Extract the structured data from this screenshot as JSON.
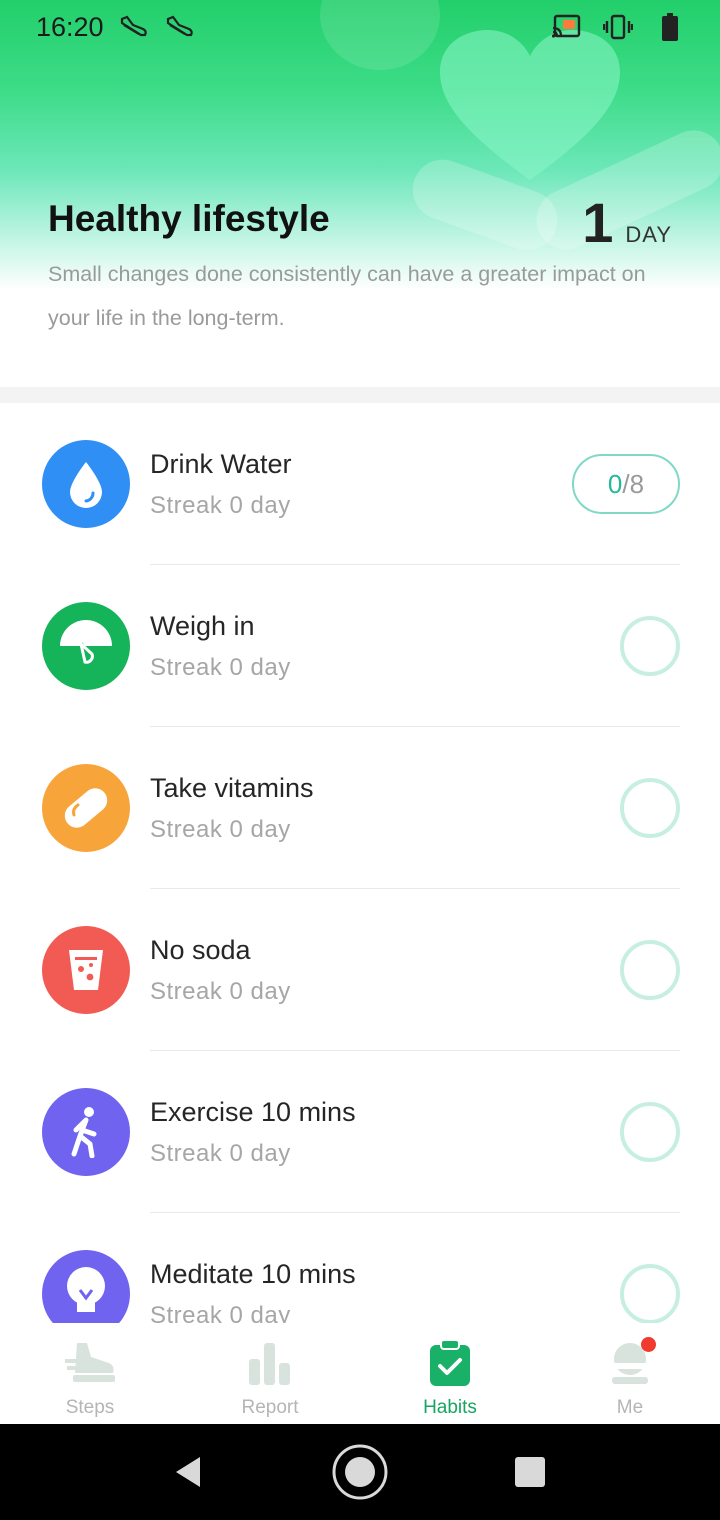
{
  "status_bar": {
    "time": "16:20",
    "left_icons": [
      "shoe-icon",
      "shoe-icon"
    ],
    "right_icons": [
      "cast-icon",
      "vibrate-icon",
      "battery-icon"
    ]
  },
  "header": {
    "title": "Healthy lifestyle",
    "day_count": "1",
    "day_unit": "DAY",
    "subtitle": "Small changes done consistently can have a greater impact on your life in the long-term."
  },
  "habits": [
    {
      "name": "Drink Water",
      "streak": "Streak 0 day",
      "icon": "water-drop-icon",
      "color": "#2f8ff5",
      "counter": {
        "current": "0",
        "separator": "/",
        "total": "8"
      }
    },
    {
      "name": "Weigh in",
      "streak": "Streak 0 day",
      "icon": "scale-icon",
      "color": "#15b35a"
    },
    {
      "name": "Take vitamins",
      "streak": "Streak 0 day",
      "icon": "pill-icon",
      "color": "#f7a53b"
    },
    {
      "name": "No soda",
      "streak": "Streak 0 day",
      "icon": "soda-cup-icon",
      "color": "#f25b54"
    },
    {
      "name": "Exercise 10 mins",
      "streak": "Streak 0 day",
      "icon": "walking-person-icon",
      "color": "#6f63f0"
    },
    {
      "name": "Meditate 10 mins",
      "streak": "Streak 0 day",
      "icon": "lightbulb-icon",
      "color": "#6f63f0"
    }
  ],
  "tabs": [
    {
      "label": "Steps",
      "icon": "steps-icon",
      "active": false
    },
    {
      "label": "Report",
      "icon": "bar-chart-icon",
      "active": false
    },
    {
      "label": "Habits",
      "icon": "clipboard-check-icon",
      "active": true
    },
    {
      "label": "Me",
      "icon": "profile-icon",
      "active": false,
      "badge": true
    }
  ],
  "colors": {
    "accent": "#16a562",
    "teal": "#27b79a",
    "check_ring": "#c6efe2",
    "badge": "#f03a2e"
  },
  "nav": [
    "back-icon",
    "home-icon",
    "recents-icon"
  ]
}
